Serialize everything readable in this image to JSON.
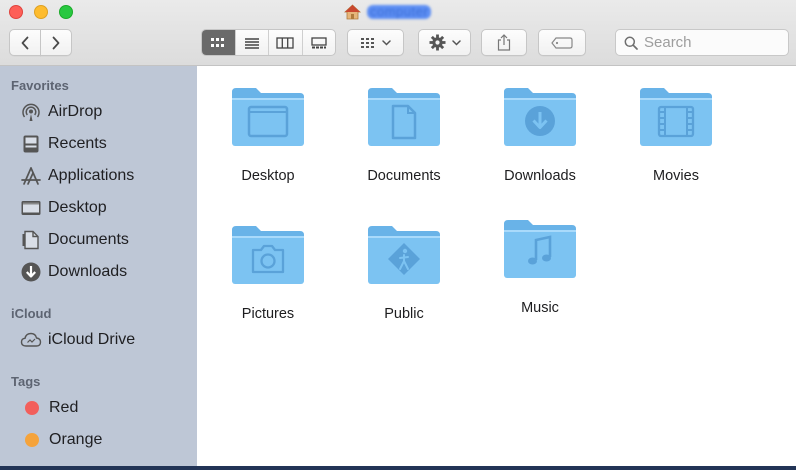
{
  "window": {
    "title": "computer",
    "title_icon": "home-icon"
  },
  "toolbar": {
    "back_icon": "chevron-left-icon",
    "forward_icon": "chevron-right-icon",
    "view_modes": [
      "icon-view",
      "list-view",
      "column-view",
      "gallery-view"
    ],
    "active_view": "icon-view",
    "group_icon": "group-grid-icon",
    "action_icon": "gear-icon",
    "share_icon": "share-icon",
    "tag_icon": "tag-icon",
    "search_placeholder": "Search"
  },
  "sidebar": {
    "favorites_label": "Favorites",
    "favorites": [
      {
        "label": "AirDrop",
        "icon": "airdrop-icon"
      },
      {
        "label": "Recents",
        "icon": "recents-icon"
      },
      {
        "label": "Applications",
        "icon": "applications-icon"
      },
      {
        "label": "Desktop",
        "icon": "desktop-icon"
      },
      {
        "label": "Documents",
        "icon": "documents-icon"
      },
      {
        "label": "Downloads",
        "icon": "downloads-icon"
      }
    ],
    "icloud_label": "iCloud",
    "icloud": [
      {
        "label": "iCloud Drive",
        "icon": "icloud-icon"
      }
    ],
    "tags_label": "Tags",
    "tags": [
      {
        "label": "Red",
        "color": "#f25f5c"
      },
      {
        "label": "Orange",
        "color": "#f5a33b"
      }
    ]
  },
  "content": {
    "folders": [
      {
        "label": "Desktop",
        "badge": "desktop-badge-icon"
      },
      {
        "label": "Documents",
        "badge": "document-badge-icon"
      },
      {
        "label": "Downloads",
        "badge": "download-badge-icon"
      },
      {
        "label": "Movies",
        "badge": "film-badge-icon"
      },
      {
        "label": "Pictures",
        "badge": "camera-badge-icon"
      },
      {
        "label": "Public",
        "badge": "public-badge-icon"
      },
      {
        "label": "Music",
        "badge": "music-badge-icon"
      }
    ]
  },
  "colors": {
    "folder_body": "#7cc3f2",
    "folder_tab": "#69b3e8",
    "sidebar_bg": "#bec7d6",
    "accent": "#5d8ef3"
  }
}
